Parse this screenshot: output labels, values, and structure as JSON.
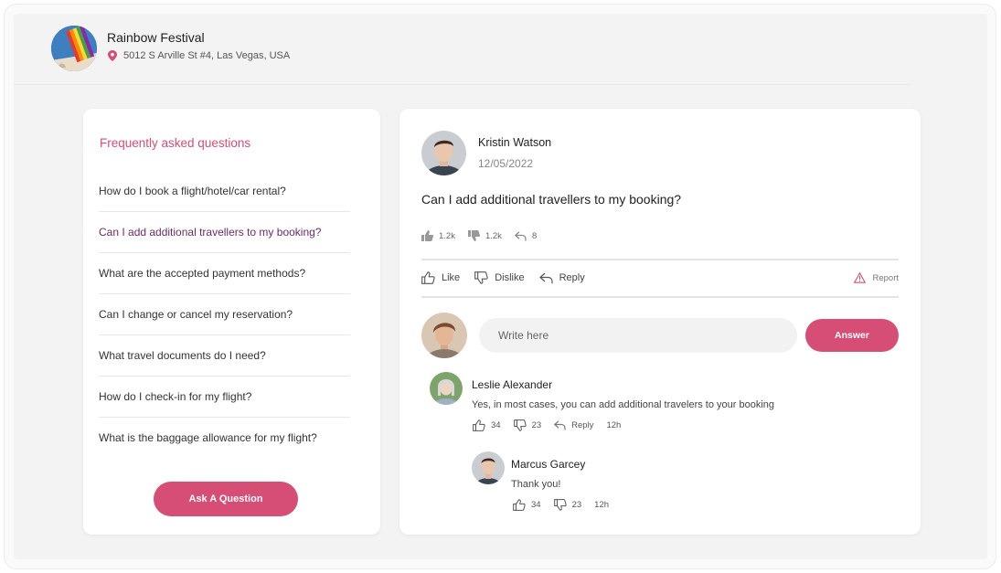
{
  "header": {
    "title": "Rainbow Festival",
    "address": "5012 S Arville St #4, Las Vegas, USA"
  },
  "faq": {
    "heading": "Frequently asked questions",
    "items": [
      "How do I book a flight/hotel/car rental?",
      "Can I add additional travellers to my booking?",
      "What are the accepted payment methods?",
      "Can I change or cancel my reservation?",
      "What travel documents do I need?",
      "How do I check-in for my flight?",
      "What is the baggage allowance for my flight?"
    ],
    "active_index": 1,
    "ask_button": "Ask A Question"
  },
  "post": {
    "author": "Kristin Watson",
    "date": "12/05/2022",
    "question": "Can I add additional travellers to my booking?",
    "stats": {
      "likes": "1.2k",
      "dislikes": "1.2k",
      "replies": "8"
    },
    "actions": {
      "like": "Like",
      "dislike": "Dislike",
      "reply": "Reply",
      "report": "Report"
    },
    "compose": {
      "placeholder": "Write here",
      "answer_button": "Answer"
    }
  },
  "comments": [
    {
      "name": "Leslie Alexander",
      "text": "Yes, in most cases, you can add additional travelers to your booking",
      "likes": "34",
      "dislikes": "23",
      "reply": "Reply",
      "time": "12h"
    },
    {
      "name": "Marcus Garcey",
      "text": "Thank you!",
      "likes": "34",
      "dislikes": "23",
      "time": "12h"
    }
  ],
  "colors": {
    "accent": "#d64d76",
    "active_question": "#6a2c66",
    "location_pin": "#d64d76"
  },
  "icons": [
    "location-pin-icon",
    "thumbs-up-icon",
    "thumbs-down-icon",
    "reply-icon",
    "warning-icon"
  ]
}
